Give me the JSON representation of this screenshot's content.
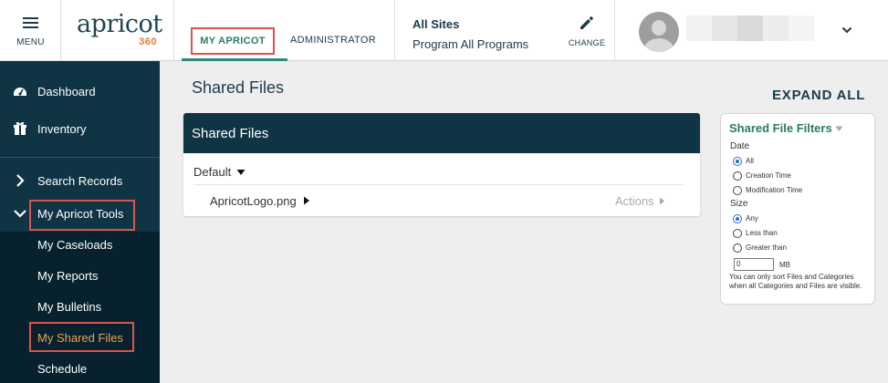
{
  "header": {
    "menu_label": "MENU",
    "logo_word": "apricot",
    "logo_num": "360",
    "tabs": [
      {
        "label": "MY APRICOT"
      },
      {
        "label": "ADMINISTRATOR"
      }
    ],
    "site_title": "All Sites",
    "site_program": "Program All Programs",
    "change_label": "CHANGE"
  },
  "sidebar": {
    "items": [
      {
        "label": "Dashboard",
        "icon": "dashboard-icon"
      },
      {
        "label": "Inventory",
        "icon": "inventory-icon"
      },
      {
        "label": "Search Records",
        "icon": "chevron-right-icon"
      },
      {
        "label": "My Apricot Tools",
        "icon": "chevron-down-icon"
      },
      {
        "label": "My Caseloads"
      },
      {
        "label": "My Reports"
      },
      {
        "label": "My Bulletins"
      },
      {
        "label": "My Shared Files"
      },
      {
        "label": "Schedule"
      }
    ]
  },
  "main": {
    "page_title": "Shared Files",
    "expand_all": "EXPAND ALL",
    "panel": {
      "title": "Shared Files",
      "category": "Default",
      "file_name": "ApricotLogo.png",
      "actions_label": "Actions"
    }
  },
  "filters": {
    "title": "Shared File Filters",
    "date_label": "Date",
    "date_options": [
      "All",
      "Creation Time",
      "Modification Time"
    ],
    "date_selected": "All",
    "size_label": "Size",
    "size_options": [
      "Any",
      "Less than",
      "Greater than"
    ],
    "size_selected": "Any",
    "size_value": "0",
    "size_unit": "MB",
    "note": "You can only sort Files and Categories when all Categories and Files are visible."
  },
  "colors": {
    "sidebar_bg": "#0f3443",
    "accent_teal": "#2a7a6a",
    "highlight_red": "#d9534f",
    "active_orange": "#e8a25c"
  }
}
